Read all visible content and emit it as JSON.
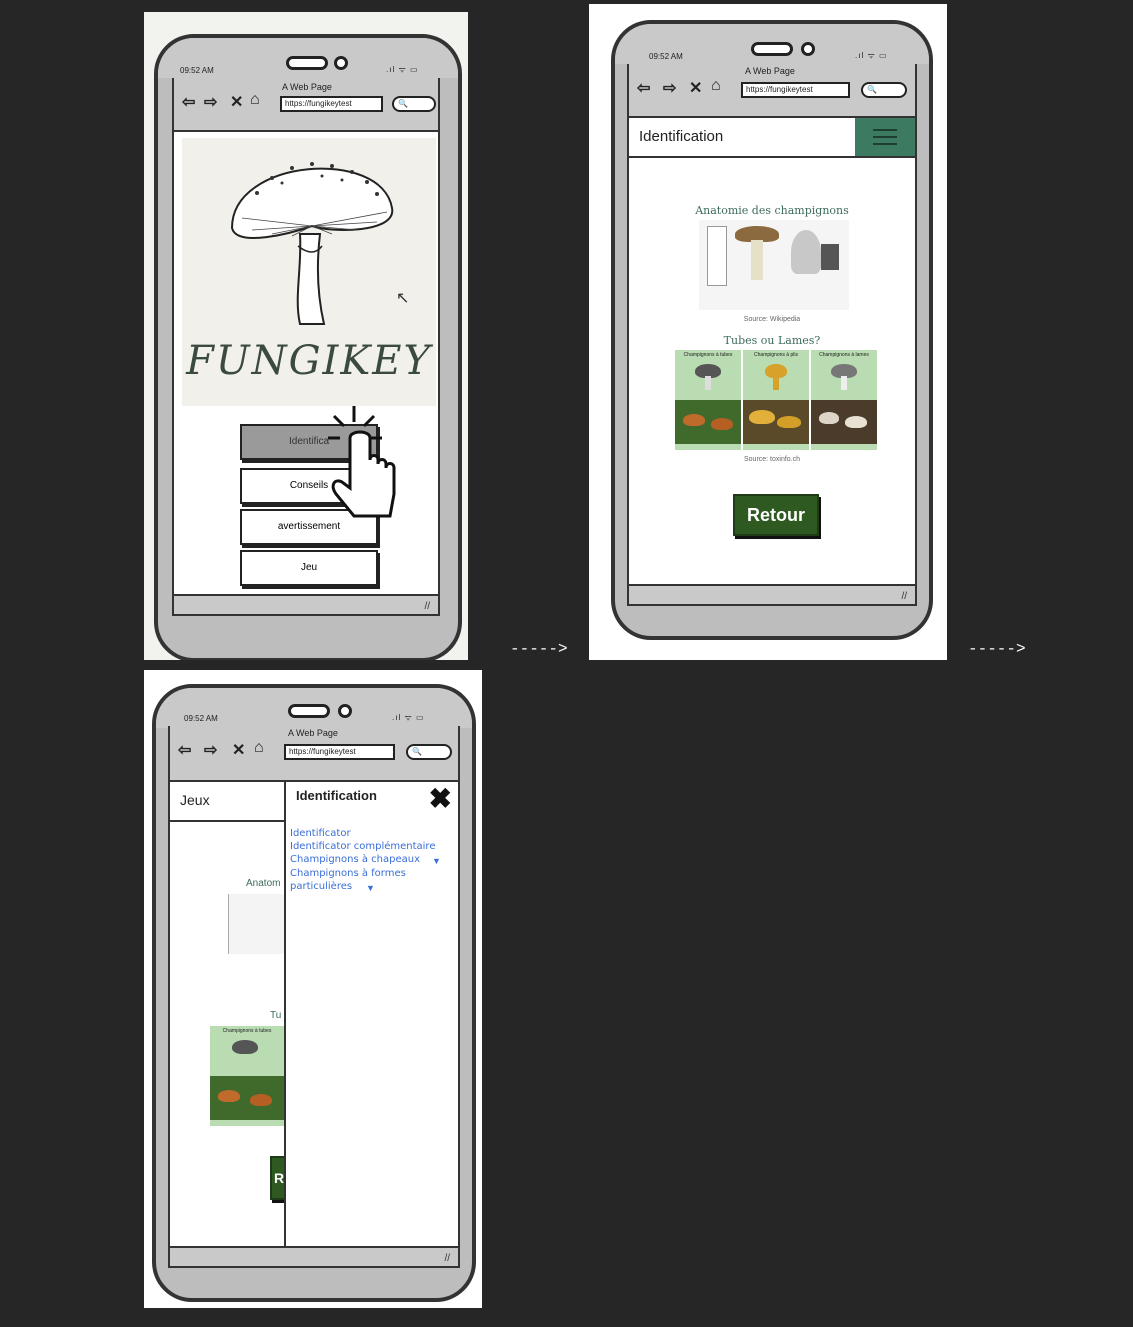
{
  "phone": {
    "time": "09:52 AM",
    "status_icons": ".ıl ᯤ ▭",
    "browser_title": "A Web Page",
    "url": "https://fungikeytest",
    "nav_icons": [
      "back-arrow-icon",
      "forward-arrow-icon",
      "close-icon",
      "home-icon"
    ]
  },
  "screen1": {
    "logo_text": "FUNGIKEY",
    "menu": [
      "Identifica",
      "Conseils",
      "avertissement",
      "Jeu"
    ]
  },
  "arrow_text": "----->",
  "screen2": {
    "header_title": "Identification",
    "anatomy_title": "Anatomie des champignons",
    "anatomy_source": "Source: Wikipedia",
    "tubes_title": "Tubes ou Lames?",
    "columns": [
      "Champignons à tubes",
      "Champignons à plis",
      "Champignons à lames"
    ],
    "tubes_source": "Source: toxinfo.ch",
    "retour_label": "Retour"
  },
  "screen3": {
    "header_left": "Jeux",
    "drawer_title": "Identification",
    "bg_text_anatomy": "Anatom",
    "bg_text_tubes": "Tu",
    "bg_col_label": "Champignons à tubes",
    "bg_retour": "R",
    "links": [
      "Identificator",
      "Identificator complémentaire",
      "Champignons à chapeaux",
      "Champignons à formes",
      "particulières"
    ]
  }
}
